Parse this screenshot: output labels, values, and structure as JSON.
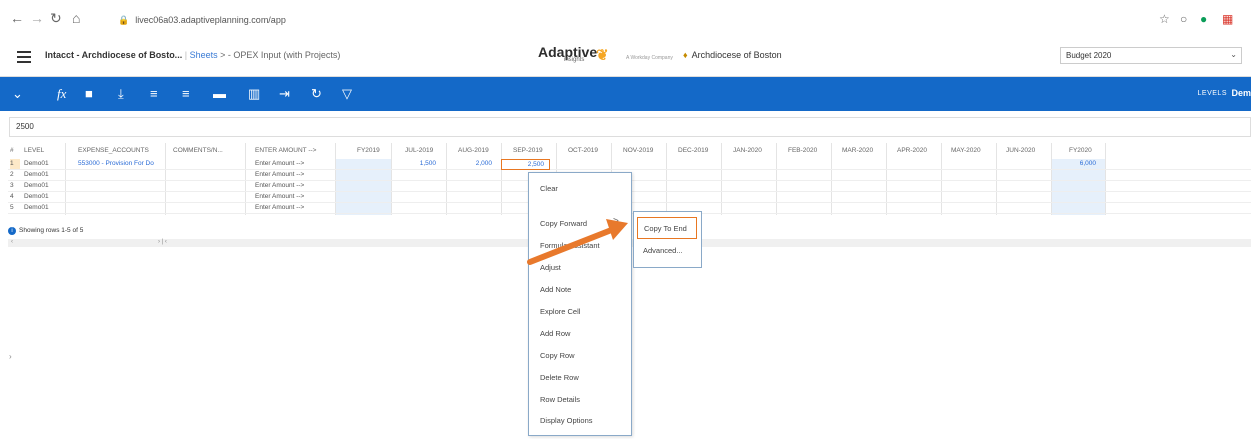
{
  "browser": {
    "url": "livec06a03.adaptiveplanning.com/app"
  },
  "header": {
    "org": "Intacct - Archdiocese of Bosto...",
    "sheets_link": "Sheets",
    "separator": ">",
    "current_sheet": "- OPEX Input (with Projects)",
    "logo_main": "Adaptive",
    "logo_sub": "insights",
    "logo_tag": "A Workday Company",
    "org_name": "Archdiocese of Boston",
    "budget": "Budget 2020"
  },
  "toolbar": {
    "levels": "LEVELS",
    "dem": "Dem"
  },
  "formula_bar": {
    "value": "2500"
  },
  "grid": {
    "columns": [
      "#",
      "LEVEL",
      "EXPENSE_ACCOUNTS",
      "COMMENTS/N...",
      "ENTER AMOUNT -->",
      "FY2019",
      "JUL-2019",
      "AUG-2019",
      "SEP-2019",
      "OCT-2019",
      "NOV-2019",
      "DEC-2019",
      "JAN-2020",
      "FEB-2020",
      "MAR-2020",
      "APR-2020",
      "MAY-2020",
      "JUN-2020",
      "FY2020"
    ],
    "rows": [
      {
        "num": "1",
        "level": "Demo01",
        "account": "553000 - Provision For Do",
        "enter": "Enter Amount -->",
        "jul": "1,500",
        "aug": "2,000",
        "sep": "2,500",
        "fy2020": "6,000"
      },
      {
        "num": "2",
        "level": "Demo01",
        "account": "",
        "enter": "Enter Amount -->",
        "jul": "",
        "aug": "",
        "sep": "",
        "fy2020": ""
      },
      {
        "num": "3",
        "level": "Demo01",
        "account": "",
        "enter": "Enter Amount -->",
        "jul": "",
        "aug": "",
        "sep": "",
        "fy2020": ""
      },
      {
        "num": "4",
        "level": "Demo01",
        "account": "",
        "enter": "Enter Amount -->",
        "jul": "",
        "aug": "",
        "sep": "",
        "fy2020": ""
      },
      {
        "num": "5",
        "level": "Demo01",
        "account": "",
        "enter": "Enter Amount -->",
        "jul": "",
        "aug": "",
        "sep": "",
        "fy2020": ""
      }
    ],
    "status": "Showing rows 1-5 of 5"
  },
  "context_menu": {
    "items": [
      "Clear",
      "Copy Forward",
      "Formula Assistant",
      "Adjust",
      "Add Note",
      "Explore Cell",
      "Add Row",
      "Copy Row",
      "Delete Row",
      "Row Details",
      "Display Options"
    ],
    "submenu": [
      "Copy To End",
      "Advanced..."
    ]
  },
  "colors": {
    "toolbar": "#1469c8",
    "selection": "#e87722",
    "link": "#3a7bd5"
  }
}
